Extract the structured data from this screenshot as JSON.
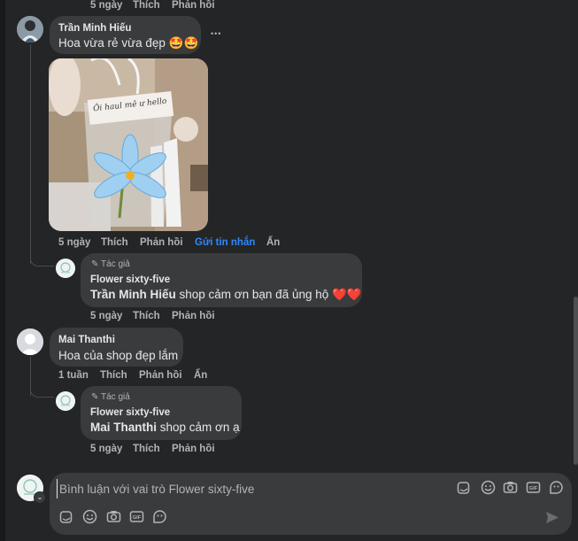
{
  "top_meta": {
    "time": "5 ngày",
    "like": "Thích",
    "reply": "Phản hồi"
  },
  "comment1": {
    "name": "Trần Minh Hiếu",
    "text": "Hoa vừa rẻ vừa đẹp 🤩🤩",
    "more": "•••",
    "meta": {
      "time": "5 ngày",
      "like": "Thích",
      "reply": "Phản hồi",
      "send": "Gửi tin nhắn",
      "hide": "Ẩn"
    },
    "image_text": "Ôi haul mê ư hello"
  },
  "reply1": {
    "author_tag": "Tác giả",
    "name": "Flower sixty-five",
    "mention": "Trần Minh Hiếu",
    "text": " shop cảm ơn bạn đã ủng hộ ❤️❤️",
    "meta": {
      "time": "5 ngày",
      "like": "Thích",
      "reply": "Phản hồi"
    }
  },
  "comment2": {
    "name": "Mai Thanthi",
    "text": "Hoa của shop đẹp lắm",
    "meta": {
      "time": "1 tuần",
      "like": "Thích",
      "reply": "Phản hồi",
      "hide": "Ẩn"
    }
  },
  "reply2": {
    "author_tag": "Tác giả",
    "name": "Flower sixty-five",
    "mention": "Mai Thanthi",
    "text": " shop cảm ơn ạ",
    "meta": {
      "time": "5 ngày",
      "like": "Thích",
      "reply": "Phản hồi"
    }
  },
  "composer": {
    "placeholder": "Bình luận với vai trò Flower sixty-five",
    "icons": [
      "sticker-icon",
      "emoji-icon",
      "camera-icon",
      "gif-icon",
      "avatar-sticker-icon",
      "send-icon"
    ]
  }
}
